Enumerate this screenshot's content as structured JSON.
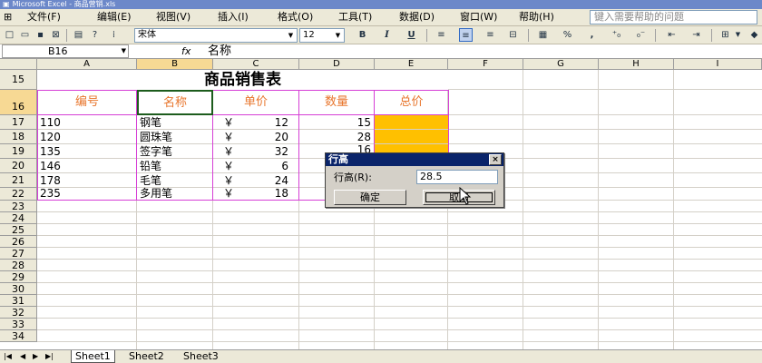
{
  "window": {
    "title": "Microsoft Excel - 商品营销.xls"
  },
  "menu": [
    "文件(F)",
    "编辑(E)",
    "视图(V)",
    "插入(I)",
    "格式(O)",
    "工具(T)",
    "数据(D)",
    "窗口(W)",
    "帮助(H)"
  ],
  "help_box": {
    "placeholder": "键入需要帮助的问题"
  },
  "toolbar": {
    "font": "宋体",
    "size": "12",
    "bold": "B",
    "italic": "I",
    "underline": "U",
    "percent": "%",
    "comma": ","
  },
  "formula_bar": {
    "cell_ref": "B16",
    "fx": "fx",
    "value": "名称"
  },
  "columns": [
    "A",
    "B",
    "C",
    "D",
    "E",
    "F",
    "G",
    "H",
    "I"
  ],
  "rows": [
    "15",
    "16",
    "17",
    "18",
    "19",
    "20",
    "21",
    "22",
    "23",
    "24",
    "25",
    "26",
    "27",
    "28",
    "29",
    "30",
    "31",
    "32",
    "33",
    "34"
  ],
  "sheet": {
    "title": "商品销售表",
    "headers": [
      "编号",
      "名称",
      "单价",
      "数量",
      "总价"
    ],
    "currency": "￥",
    "data": [
      {
        "id": "110",
        "name": "钢笔",
        "price": "12",
        "qty": "15"
      },
      {
        "id": "120",
        "name": "圆珠笔",
        "price": "20",
        "qty": "28"
      },
      {
        "id": "135",
        "name": "签字笔",
        "price": "32",
        "qty": "16"
      },
      {
        "id": "146",
        "name": "铅笔",
        "price": "6",
        "qty": ""
      },
      {
        "id": "178",
        "name": "毛笔",
        "price": "24",
        "qty": ""
      },
      {
        "id": "235",
        "name": "多用笔",
        "price": "18",
        "qty": ""
      }
    ]
  },
  "sheet_tabs": [
    "Sheet1",
    "Sheet2",
    "Sheet3"
  ],
  "dialog": {
    "title": "行高",
    "close": "×",
    "label": "行高(R):",
    "value": "28.5",
    "ok": "确定",
    "cancel": "取消"
  },
  "colors": {
    "title_bar": "#6c88c9",
    "accent_orange": "#ffc000",
    "header_text": "#e8762d",
    "border_magenta": "#d63fd6"
  }
}
